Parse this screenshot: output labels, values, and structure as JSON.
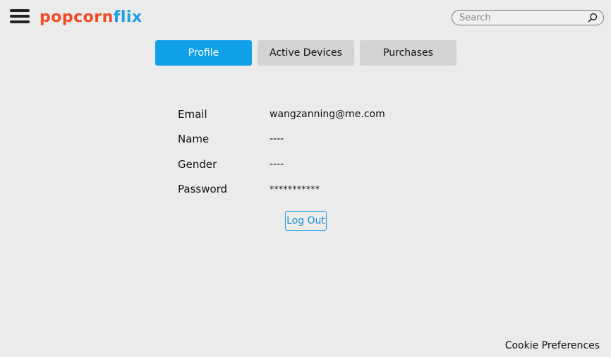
{
  "header": {
    "logo_part1": "popcorn",
    "logo_part2": "flix",
    "search_placeholder": "Search"
  },
  "tabs": [
    {
      "label": "Profile",
      "active": true
    },
    {
      "label": "Active Devices",
      "active": false
    },
    {
      "label": "Purchases",
      "active": false
    }
  ],
  "profile": {
    "email_label": "Email",
    "email_value": "wangzanning@me.com",
    "name_label": "Name",
    "name_value": "----",
    "gender_label": "Gender",
    "gender_value": "----",
    "password_label": "Password",
    "password_value": "***********"
  },
  "logout_label": "Log Out",
  "footer": {
    "cookie_label": "Cookie Preferences"
  },
  "colors": {
    "background": "#ebebeb",
    "accent": "#0fa0e8",
    "logo_orange": "#f04a23",
    "logo_blue": "#1ea0e6",
    "tab_inactive": "#d3d3d3"
  },
  "icons": {
    "menu": "hamburger-menu-icon",
    "search": "search-icon"
  }
}
